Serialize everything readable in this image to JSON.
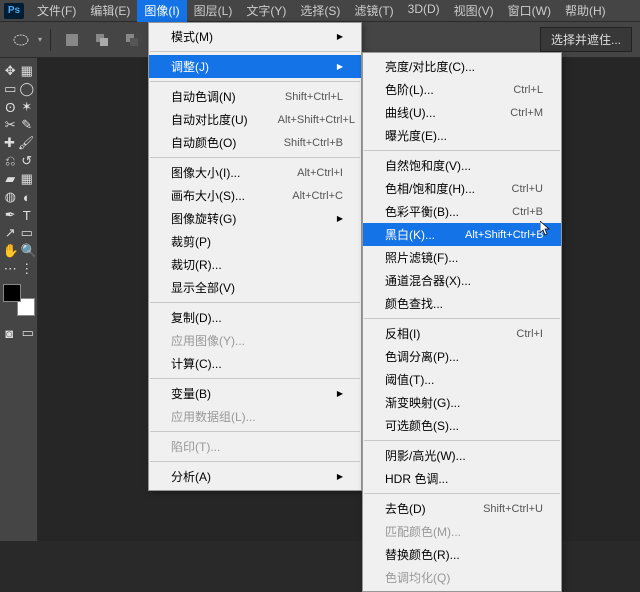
{
  "logo": "Ps",
  "menubar": [
    "文件(F)",
    "编辑(E)",
    "图像(I)",
    "图层(L)",
    "文字(Y)",
    "选择(S)",
    "滤镜(T)",
    "3D(D)",
    "视图(V)",
    "窗口(W)",
    "帮助(H)"
  ],
  "active_menu_index": 2,
  "optbar_chip": "选择并遮住...",
  "menu_image": [
    {
      "label": "模式(M)",
      "arrow": true
    },
    {
      "sep": true
    },
    {
      "label": "调整(J)",
      "arrow": true,
      "hl": true
    },
    {
      "sep": true
    },
    {
      "label": "自动色调(N)",
      "sc": "Shift+Ctrl+L"
    },
    {
      "label": "自动对比度(U)",
      "sc": "Alt+Shift+Ctrl+L"
    },
    {
      "label": "自动颜色(O)",
      "sc": "Shift+Ctrl+B"
    },
    {
      "sep": true
    },
    {
      "label": "图像大小(I)...",
      "sc": "Alt+Ctrl+I"
    },
    {
      "label": "画布大小(S)...",
      "sc": "Alt+Ctrl+C"
    },
    {
      "label": "图像旋转(G)",
      "arrow": true
    },
    {
      "label": "裁剪(P)"
    },
    {
      "label": "裁切(R)..."
    },
    {
      "label": "显示全部(V)"
    },
    {
      "sep": true
    },
    {
      "label": "复制(D)..."
    },
    {
      "label": "应用图像(Y)...",
      "disabled": true
    },
    {
      "label": "计算(C)..."
    },
    {
      "sep": true
    },
    {
      "label": "变量(B)",
      "arrow": true
    },
    {
      "label": "应用数据组(L)...",
      "disabled": true
    },
    {
      "sep": true
    },
    {
      "label": "陷印(T)...",
      "disabled": true
    },
    {
      "sep": true
    },
    {
      "label": "分析(A)",
      "arrow": true
    }
  ],
  "menu_adjust": [
    {
      "label": "亮度/对比度(C)..."
    },
    {
      "label": "色阶(L)...",
      "sc": "Ctrl+L"
    },
    {
      "label": "曲线(U)...",
      "sc": "Ctrl+M"
    },
    {
      "label": "曝光度(E)..."
    },
    {
      "sep": true
    },
    {
      "label": "自然饱和度(V)..."
    },
    {
      "label": "色相/饱和度(H)...",
      "sc": "Ctrl+U"
    },
    {
      "label": "色彩平衡(B)...",
      "sc": "Ctrl+B"
    },
    {
      "label": "黑白(K)...",
      "sc": "Alt+Shift+Ctrl+B",
      "hl": true
    },
    {
      "label": "照片滤镜(F)..."
    },
    {
      "label": "通道混合器(X)..."
    },
    {
      "label": "颜色查找..."
    },
    {
      "sep": true
    },
    {
      "label": "反相(I)",
      "sc": "Ctrl+I"
    },
    {
      "label": "色调分离(P)..."
    },
    {
      "label": "阈值(T)..."
    },
    {
      "label": "渐变映射(G)..."
    },
    {
      "label": "可选颜色(S)..."
    },
    {
      "sep": true
    },
    {
      "label": "阴影/高光(W)..."
    },
    {
      "label": "HDR 色调..."
    },
    {
      "sep": true
    },
    {
      "label": "去色(D)",
      "sc": "Shift+Ctrl+U"
    },
    {
      "label": "匹配颜色(M)...",
      "disabled": true
    },
    {
      "label": "替换颜色(R)..."
    },
    {
      "label": "色调均化(Q)",
      "disabled": true
    }
  ],
  "tools": [
    [
      "move",
      "artboard"
    ],
    [
      "lasso-rect",
      "lasso-ellipse"
    ],
    [
      "lasso",
      "magic-wand"
    ],
    [
      "crop",
      "eyedropper"
    ],
    [
      "spot-heal",
      "brush"
    ],
    [
      "clone",
      "history-brush"
    ],
    [
      "eraser",
      "gradient"
    ],
    [
      "blur",
      "dodge"
    ],
    [
      "pen",
      "type"
    ],
    [
      "path",
      "shape"
    ],
    [
      "hand",
      "zoom"
    ],
    [
      "options",
      "more"
    ]
  ]
}
